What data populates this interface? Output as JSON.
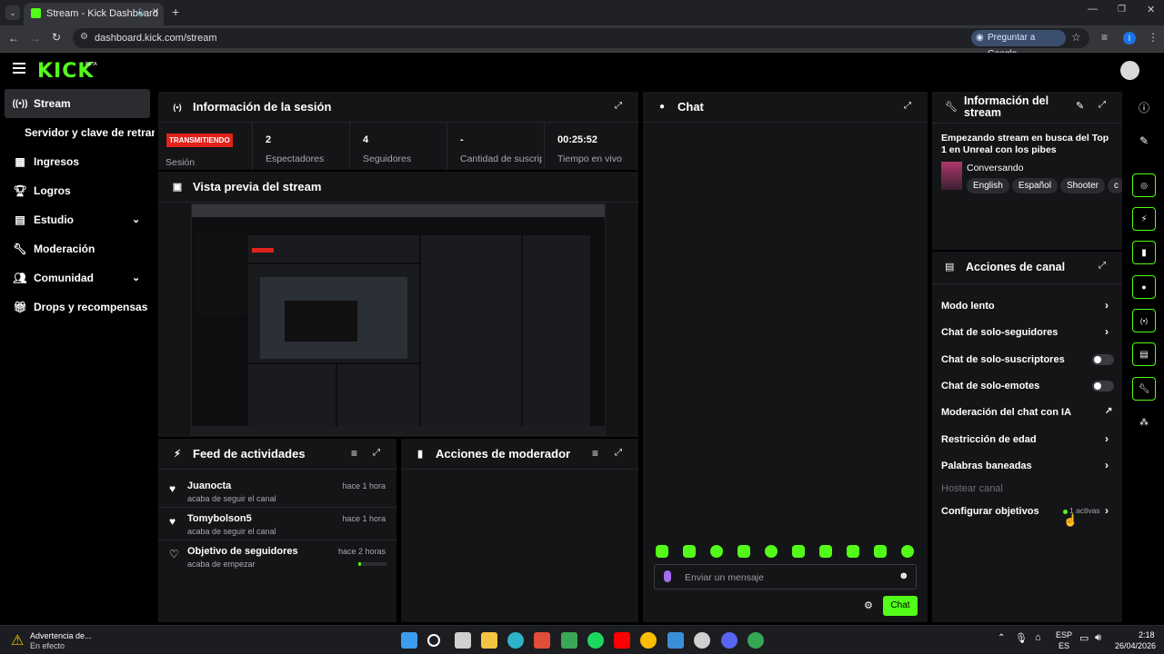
{
  "browser": {
    "tab_title": "Stream - Kick Dashboard",
    "url": "dashboard.kick.com/stream",
    "ask_google": "Preguntar a Google",
    "profile_initial": "I"
  },
  "header": {
    "logo": "KICK",
    "beta": "BETA"
  },
  "sidebar": {
    "items": [
      {
        "label": "Stream",
        "icon": "broadcast-icon"
      },
      {
        "label": "Servidor y clave de retransmisión",
        "icon": ""
      },
      {
        "label": "Ingresos",
        "icon": "chart-icon"
      },
      {
        "label": "Logros",
        "icon": "trophy-icon"
      },
      {
        "label": "Estudio",
        "icon": "layout-icon"
      },
      {
        "label": "Moderación",
        "icon": "wrench-icon"
      },
      {
        "label": "Comunidad",
        "icon": "community-icon"
      },
      {
        "label": "Drops y recompensas",
        "icon": "gift-icon"
      }
    ]
  },
  "session": {
    "title": "Información de la sesión",
    "status_badge": "TRANSMITIENDO",
    "status_label": "Sesión",
    "stats": [
      {
        "value": "2",
        "label": "Espectadores"
      },
      {
        "value": "4",
        "label": "Seguidores"
      },
      {
        "value": "-",
        "label": "Cantidad de suscripciones"
      },
      {
        "value": "00:25:52",
        "label": "Tiempo en vivo"
      }
    ]
  },
  "preview": {
    "title": "Vista previa del stream"
  },
  "feed": {
    "title": "Feed de actividades",
    "items": [
      {
        "name": "Juanocta",
        "sub": "acaba de seguir el canal",
        "time": "hace 1 hora"
      },
      {
        "name": "Tomybolson5",
        "sub": "acaba de seguir el canal",
        "time": "hace 1 hora"
      },
      {
        "name": "Objetivo de seguidores",
        "sub": "acaba de empezar",
        "time": "hace 2 horas",
        "progress": 0.08
      }
    ]
  },
  "mod_actions": {
    "title": "Acciones de moderador"
  },
  "chat": {
    "title": "Chat",
    "placeholder": "Enviar un mensaje",
    "send_label": "Chat"
  },
  "stream_info": {
    "title": "Información del stream",
    "stream_title": "Empezando stream en busca del Top 1 en Unreal con los pibes",
    "category": "Conversando",
    "tags": [
      "English",
      "Español",
      "Shooter",
      "c"
    ]
  },
  "channel_actions": {
    "title": "Acciones de canal",
    "items": [
      {
        "label": "Modo lento",
        "control": "chevron"
      },
      {
        "label": "Chat de solo-seguidores",
        "control": "chevron"
      },
      {
        "label": "Chat de solo-suscriptores",
        "control": "toggle"
      },
      {
        "label": "Chat de solo-emotes",
        "control": "toggle"
      },
      {
        "label": "Moderación del chat con IA",
        "control": "external"
      },
      {
        "label": "Restricción de edad",
        "control": "chevron"
      },
      {
        "label": "Palabras baneadas",
        "control": "chevron"
      },
      {
        "label": "Hostear canal",
        "control": "none",
        "disabled": true
      },
      {
        "label": "Configurar objetivos",
        "control": "chevron",
        "badge": "1 activas"
      }
    ]
  },
  "taskbar": {
    "warning_title": "Advertencia de...",
    "warning_sub": "En efecto",
    "lang": "ESP",
    "lang_sub": "ES",
    "time": "2:18",
    "date": "26/04/2026"
  },
  "colors": {
    "accent": "#53fc18",
    "live": "#e1221b",
    "panel": "#141517"
  }
}
